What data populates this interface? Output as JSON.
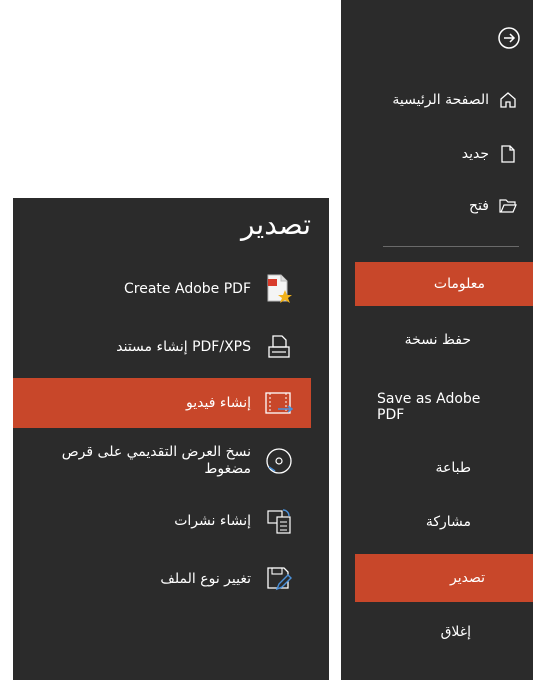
{
  "nav": {
    "items": [
      {
        "label": "الصفحة الرئيسية",
        "icon": "home-icon"
      },
      {
        "label": "جديد",
        "icon": "new-document-icon"
      },
      {
        "label": "فتح",
        "icon": "open-folder-icon"
      },
      {
        "label": "معلومات"
      },
      {
        "label": "حفظ نسخة"
      },
      {
        "label": "Save as Adobe PDF"
      },
      {
        "label": "طباعة"
      },
      {
        "label": "مشاركة"
      },
      {
        "label": "تصدير",
        "active": true
      },
      {
        "label": "إغلاق"
      }
    ],
    "back_icon": "back-arrow-icon"
  },
  "export": {
    "title": "تصدير",
    "options": [
      {
        "label": "Create Adobe PDF",
        "icon": "adobe-pdf-icon"
      },
      {
        "label": "إنشاء مستند PDF/XPS",
        "icon": "pdf-xps-icon"
      },
      {
        "label": "إنشاء فيديو",
        "icon": "video-icon",
        "active": true
      },
      {
        "label": "نسخ العرض التقديمي على قرص مضغوط",
        "icon": "cd-icon"
      },
      {
        "label": "إنشاء نشرات",
        "icon": "handouts-icon"
      },
      {
        "label": "تغيير نوع الملف",
        "icon": "change-file-type-icon"
      }
    ]
  },
  "colors": {
    "accent": "#c8472a",
    "panel": "#2b2b2b"
  }
}
